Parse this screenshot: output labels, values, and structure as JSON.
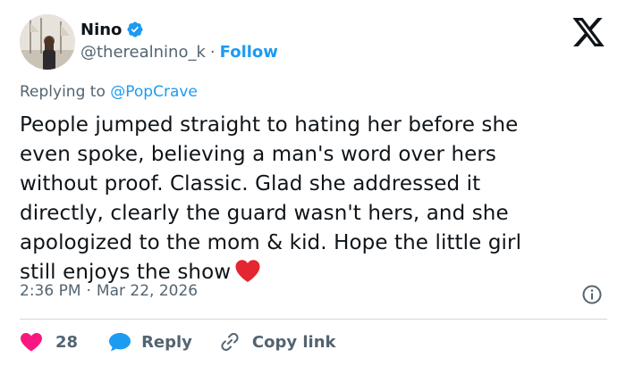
{
  "author": {
    "display_name": "Nino",
    "handle": "@therealnino_k",
    "separator": "·",
    "follow_label": "Follow",
    "verified_color": "#1d9bf0"
  },
  "replying": {
    "prefix": "Replying to ",
    "mention": "@PopCrave"
  },
  "tweet": {
    "lines": [
      "People jumped straight to hating her before she",
      "even spoke, believing a man's word over hers",
      "without proof. Classic. Glad she addressed it",
      "directly, clearly the guard wasn't hers, and she",
      "apologized to the mom & kid. Hope the little girl",
      "still enjoys the show"
    ],
    "trailing_emoji": "red-heart"
  },
  "meta": {
    "time": "2:36 PM",
    "separator": "·",
    "date": "Mar 22, 2026"
  },
  "actions": {
    "like_count": "28",
    "reply_label": "Reply",
    "copy_label": "Copy link"
  },
  "colors": {
    "accent": "#1d9bf0",
    "like": "#f91880",
    "text": "#0f1419",
    "secondary": "#536471",
    "divider": "#cfd9de"
  },
  "icons": {
    "brand": "x-logo-icon",
    "verified": "verified-badge-icon",
    "info": "info-icon",
    "like": "heart-icon",
    "reply": "reply-bubble-icon",
    "copy": "link-icon"
  }
}
